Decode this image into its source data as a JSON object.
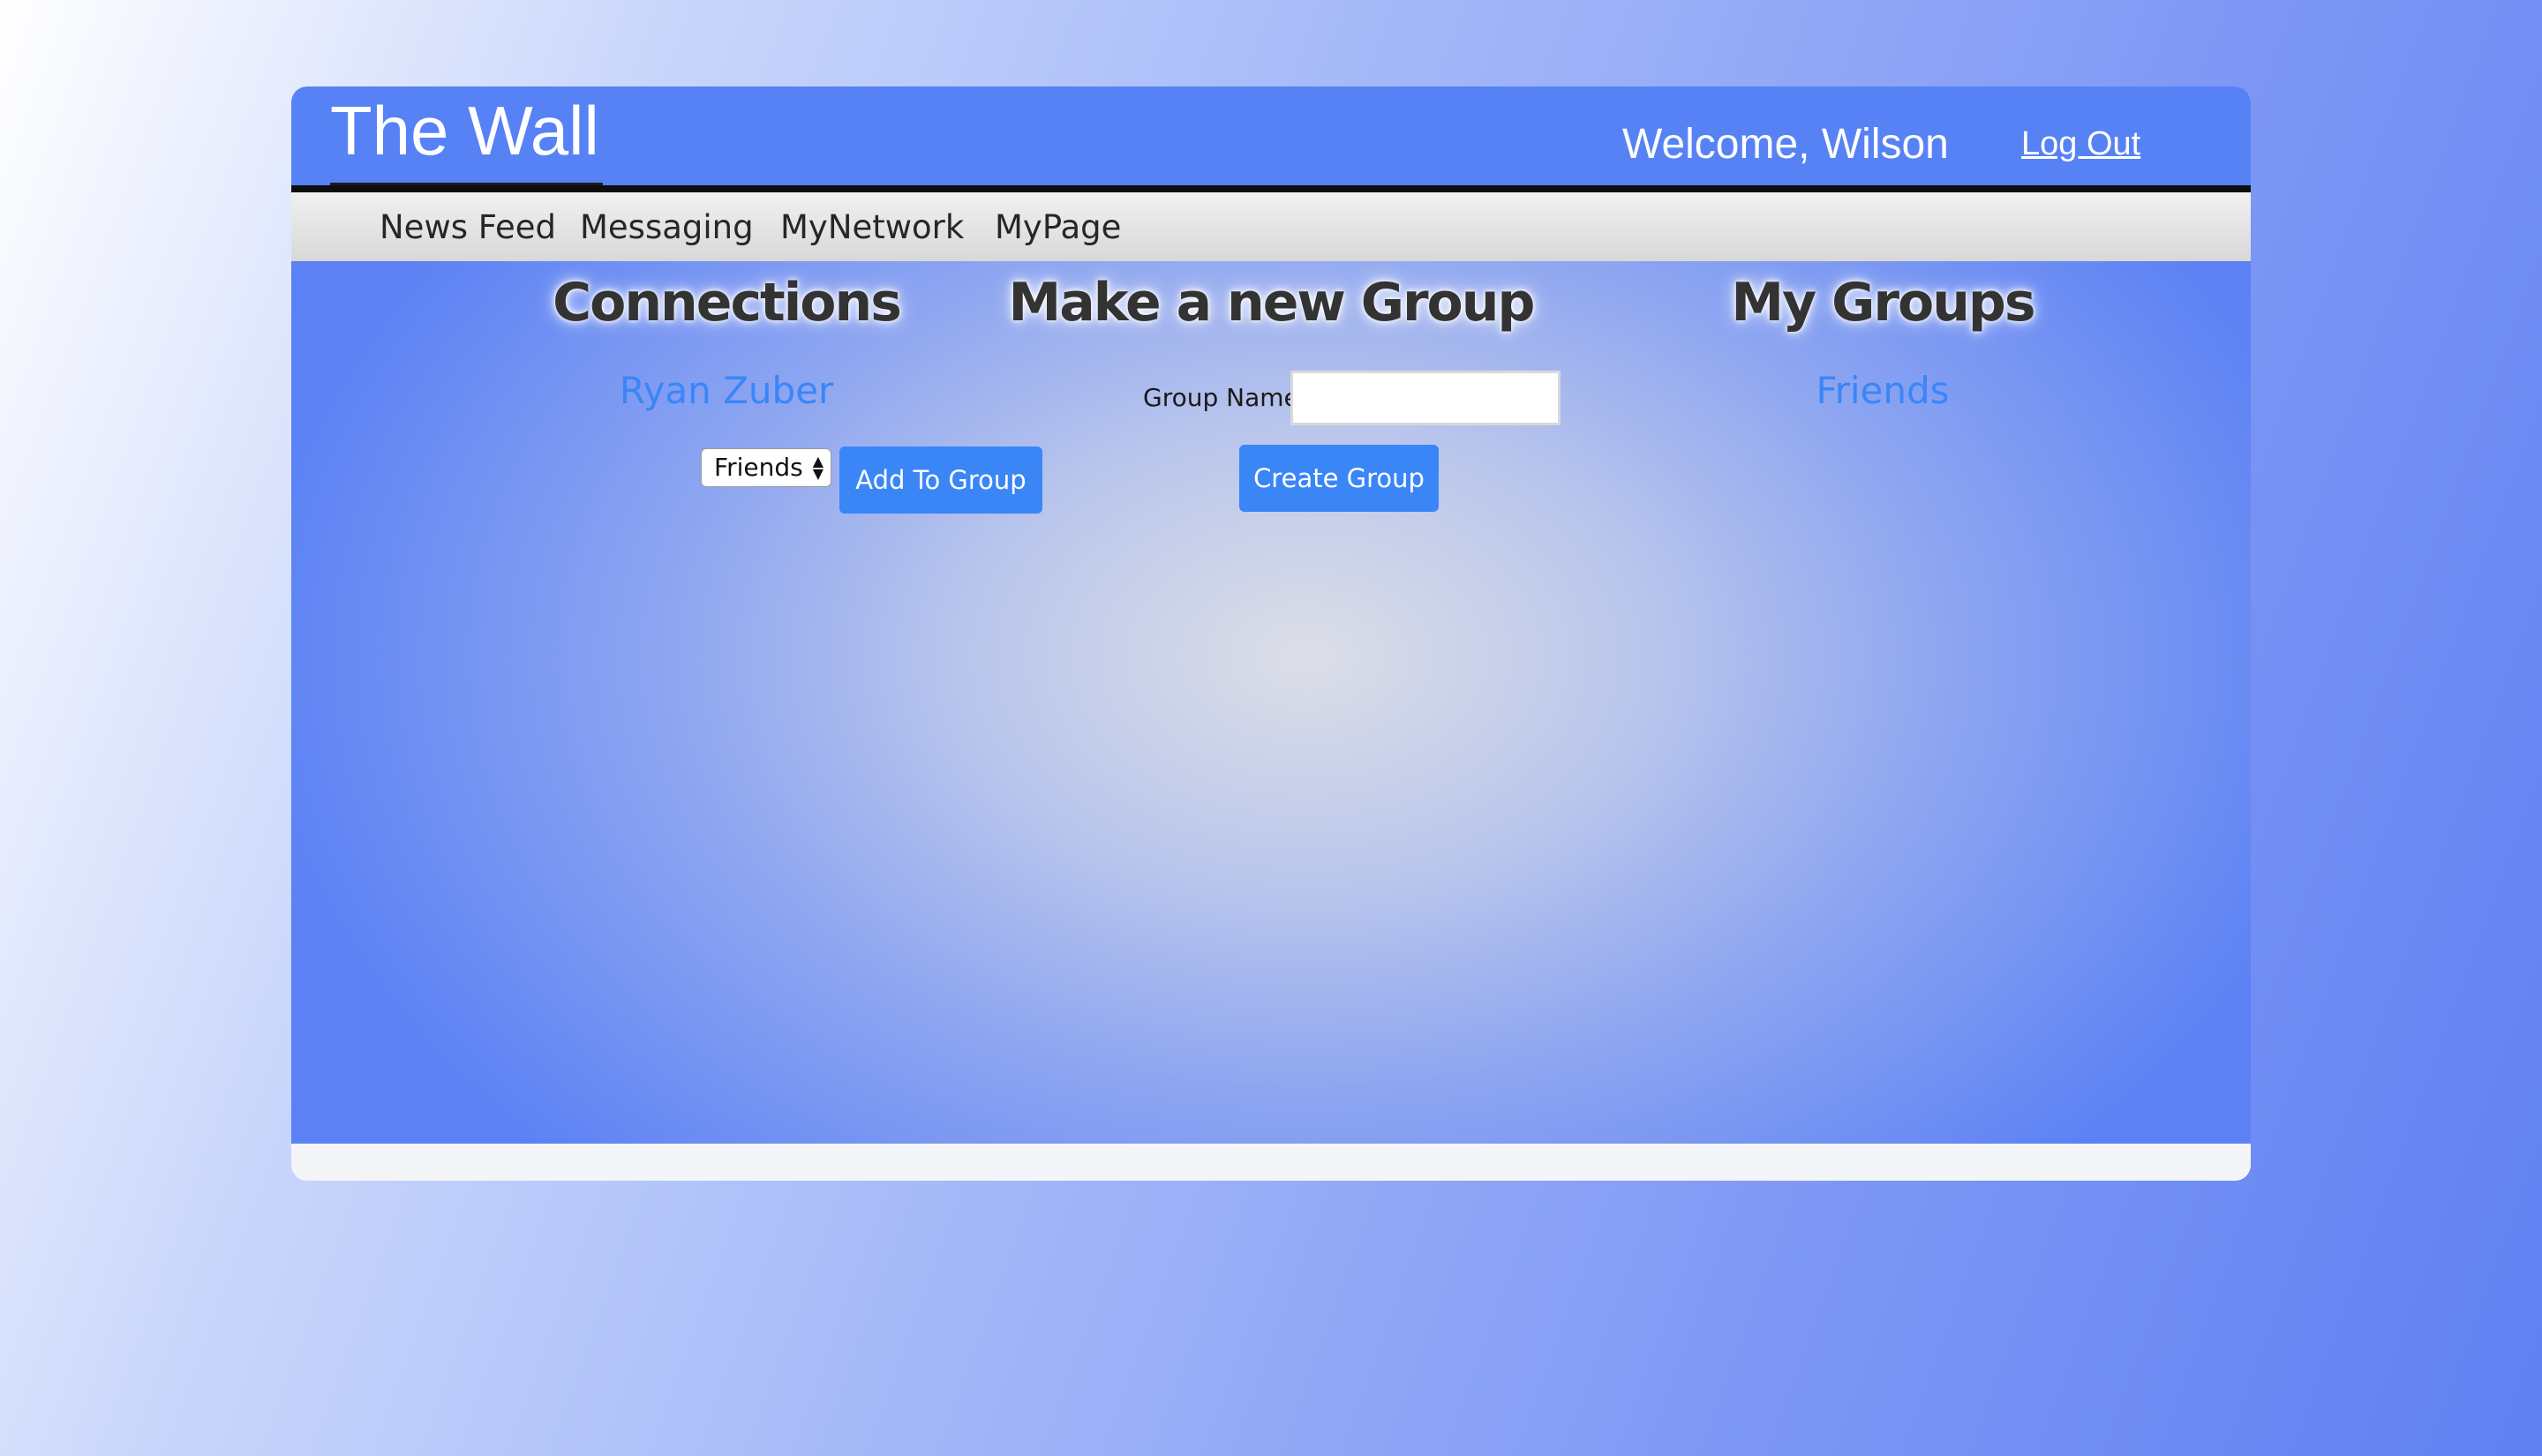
{
  "header": {
    "title": "The Wall",
    "welcome": "Welcome, Wilson",
    "logout_label": "Log Out"
  },
  "nav": {
    "items": [
      "News Feed",
      "Messaging",
      "MyNetwork",
      "MyPage"
    ]
  },
  "connections": {
    "heading": "Connections",
    "people": [
      {
        "name": "Ryan Zuber",
        "group_select_value": "Friends",
        "add_button_label": "Add To Group"
      }
    ]
  },
  "new_group": {
    "heading": "Make a new Group",
    "field_label": "Group Name",
    "field_value": "",
    "create_button_label": "Create Group"
  },
  "my_groups": {
    "heading": "My Groups",
    "groups": [
      "Friends"
    ]
  },
  "colors": {
    "header_blue": "#5682f5",
    "link_blue": "#3a86f7",
    "button_blue": "#3a86f7",
    "nav_gray": "#e0e0e0"
  }
}
